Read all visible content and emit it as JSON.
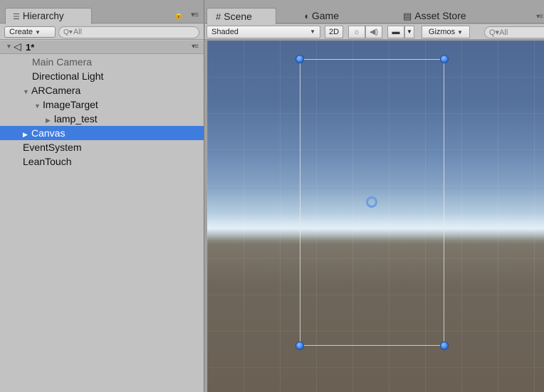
{
  "hierarchy": {
    "tab_label": "Hierarchy",
    "tab_icon": "list-icon",
    "create_label": "Create",
    "search_placeholder": "All",
    "scene_name": "1*",
    "items": [
      {
        "label": "Main Camera",
        "dim": true
      },
      {
        "label": "Directional Light"
      },
      {
        "label": "ARCamera",
        "expanded": true
      },
      {
        "label": "ImageTarget",
        "expanded": true
      },
      {
        "label": "lamp_test",
        "collapsed_child": true
      },
      {
        "label": "Canvas",
        "selected": true
      },
      {
        "label": "EventSystem"
      },
      {
        "label": "LeanTouch"
      }
    ]
  },
  "scene": {
    "tabs": [
      {
        "label": "Scene",
        "icon": "grid-hash-icon",
        "active": true
      },
      {
        "label": "Game",
        "icon": "game-pacman-icon"
      },
      {
        "label": "Asset Store",
        "icon": "store-bag-icon"
      }
    ],
    "toolbar": {
      "shading_mode": "Shaded",
      "mode_2d": "2D",
      "gizmos_label": "Gizmos",
      "search_placeholder": "All"
    }
  },
  "colors": {
    "selection": "#3e7ce0",
    "handle": "#2d6fd6",
    "panel_bg": "#c2c2c2"
  }
}
